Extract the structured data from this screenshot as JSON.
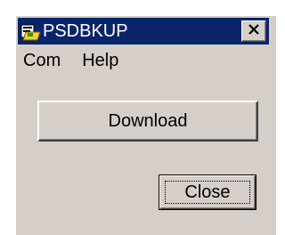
{
  "window": {
    "title": "PSDBKUP",
    "titlebar_color": "#0a246a",
    "body_color": "#d4d0c8",
    "icon": "app-folder-icon",
    "close_glyph": "close-icon"
  },
  "menubar": {
    "items": [
      {
        "label": "Com"
      },
      {
        "label": "Help"
      }
    ]
  },
  "buttons": {
    "download_label": "Download",
    "close_label": "Close"
  }
}
